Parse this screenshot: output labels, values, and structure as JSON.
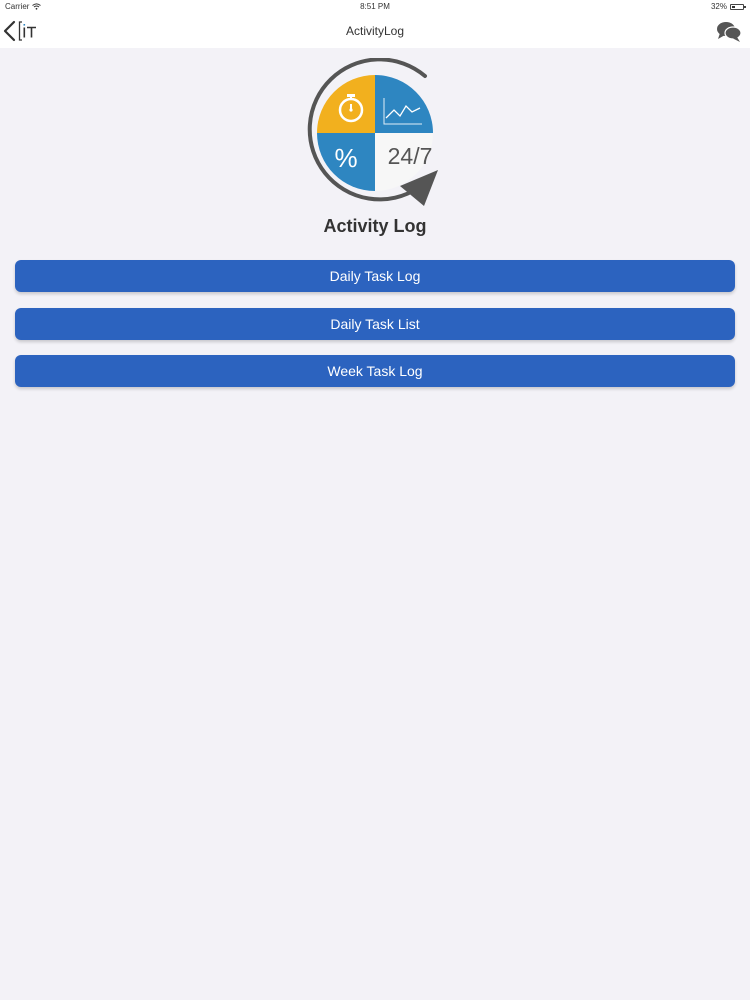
{
  "status_bar": {
    "carrier": "Carrier",
    "time": "8:51 PM",
    "battery": "32%",
    "battery_level": 0.32
  },
  "nav": {
    "title": "ActivityLog"
  },
  "hero": {
    "percent_symbol": "%",
    "availability_text": "24/7"
  },
  "page": {
    "title": "Activity Log"
  },
  "menu": {
    "items": [
      {
        "label": "Daily Task Log"
      },
      {
        "label": "Daily Task List"
      },
      {
        "label": "Week Task Log"
      }
    ]
  },
  "colors": {
    "primary_button": "#2c63bf",
    "logo_yellow": "#f2b01e",
    "logo_blue": "#2e86c1",
    "logo_gray": "#555555"
  },
  "icons": {
    "back": "chevron-left-icon",
    "logo": "app-logo-icon",
    "chat": "chat-bubbles-icon",
    "stopwatch": "stopwatch-icon",
    "chart": "line-chart-icon"
  }
}
